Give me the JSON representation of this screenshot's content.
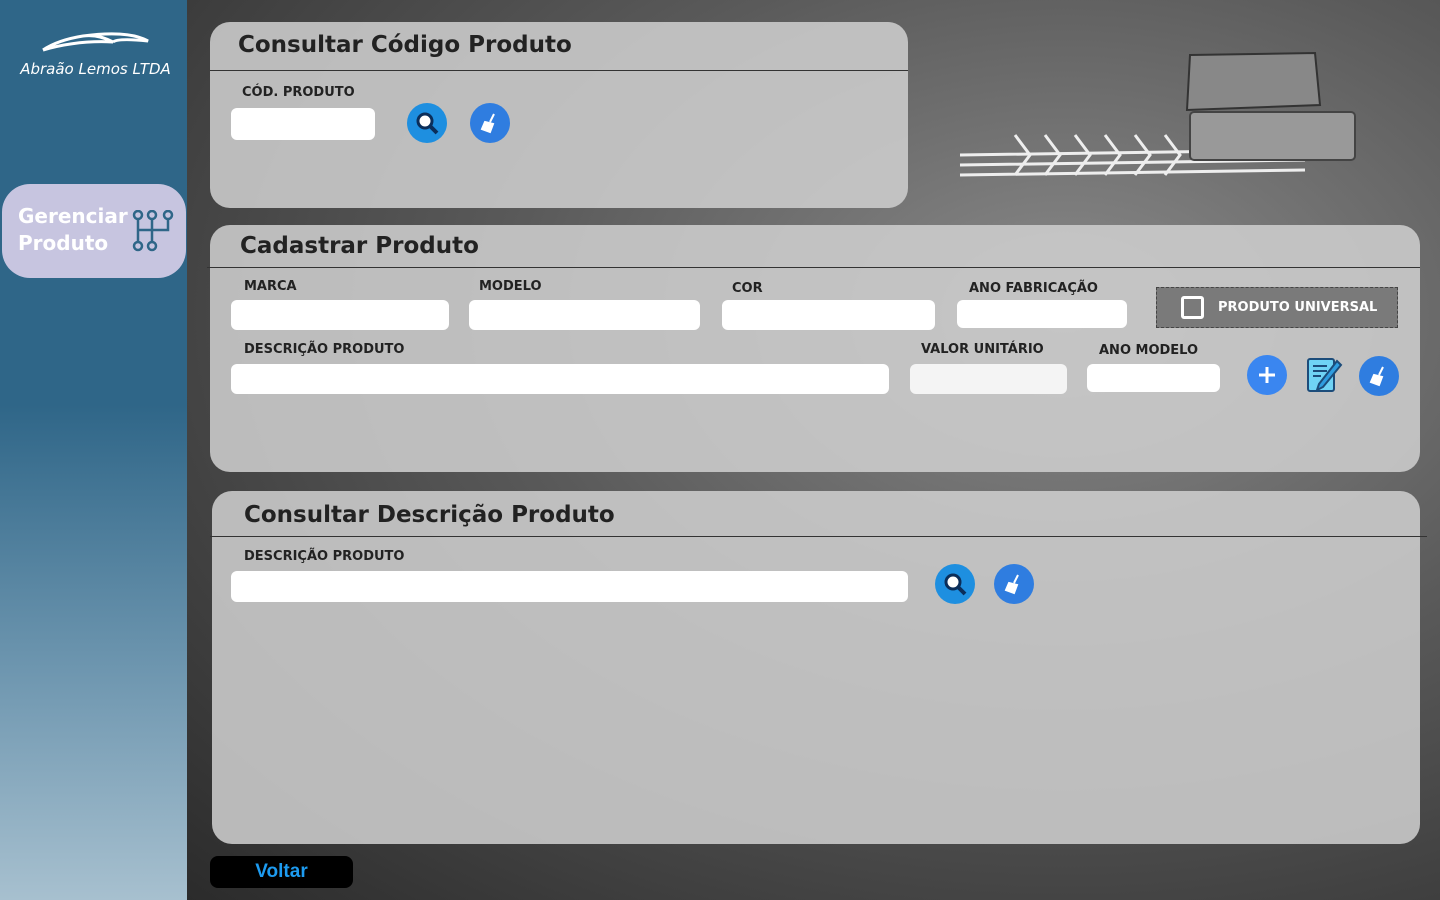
{
  "brand": {
    "name": "Abraão Lemos LTDA"
  },
  "sidebar": {
    "items": [
      {
        "label_line1": "Gerenciar",
        "label_line2": "Produto",
        "icon": "gear-shift-icon"
      }
    ]
  },
  "consultar_codigo": {
    "title": "Consultar Código Produto",
    "cod_label": "CÓD. PRODUTO",
    "cod_value": ""
  },
  "cadastrar": {
    "title": "Cadastrar Produto",
    "marca": "MARCA",
    "modelo": "MODELO",
    "cor": "COR",
    "ano_fabricacao": "ANO FABRICAÇÃO",
    "produto_universal": "PRODUTO UNIVERSAL",
    "descricao": "DESCRIÇÃO PRODUTO",
    "valor_unitario": "VALOR UNITÁRIO",
    "ano_modelo": "ANO MODELO"
  },
  "consultar_descricao": {
    "title": "Consultar Descrição Produto",
    "descricao": "DESCRIÇÃO PRODUTO"
  },
  "voltar": "Voltar",
  "colors": {
    "sidebar": "#2f6688",
    "nav": "#c7c5e0",
    "button": "#2f7de0",
    "voltar_text": "#1d9bf0"
  }
}
